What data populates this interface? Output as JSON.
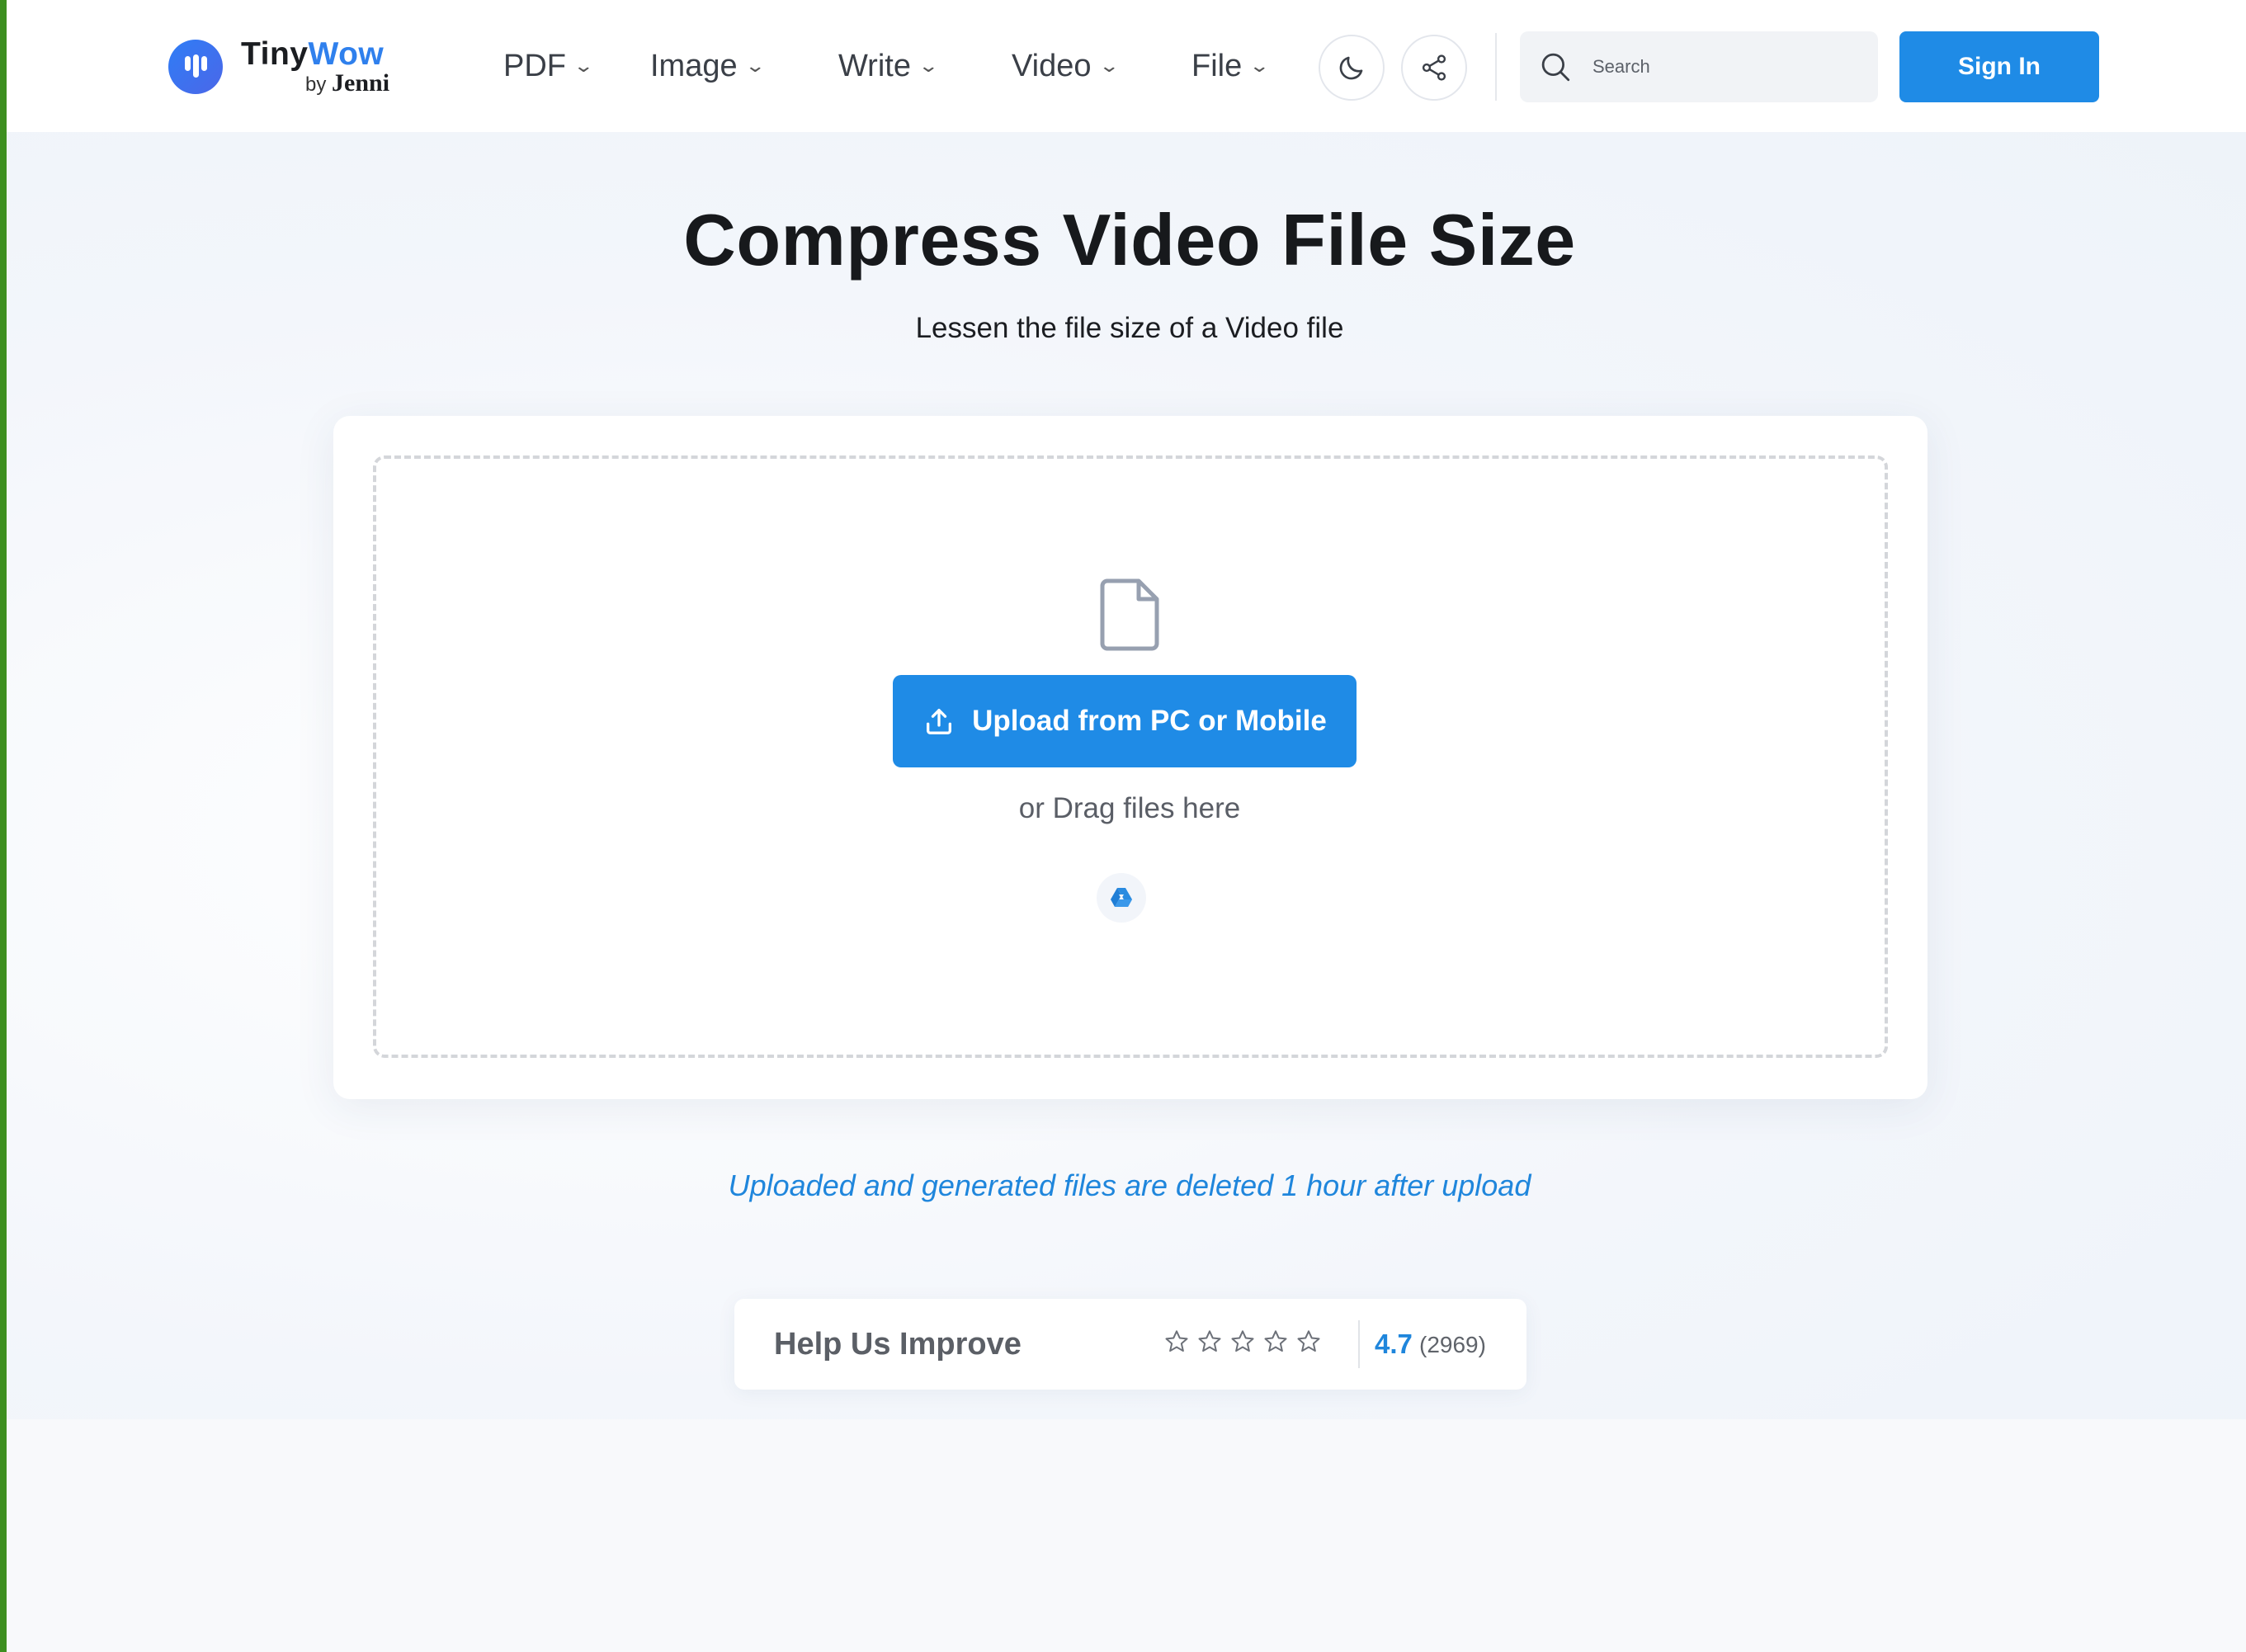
{
  "header": {
    "logo": {
      "brand_main": "Tiny",
      "brand_accent": "Wow",
      "by": "by",
      "byline": "Jenni"
    },
    "nav": [
      {
        "label": "PDF"
      },
      {
        "label": "Image"
      },
      {
        "label": "Write"
      },
      {
        "label": "Video"
      },
      {
        "label": "File"
      }
    ],
    "search": {
      "placeholder": "Search"
    },
    "sign_in_label": "Sign In",
    "icons": {
      "theme": "moon-icon",
      "share": "share-icon"
    }
  },
  "main": {
    "title": "Compress Video File Size",
    "subtitle": "Lessen the file size of a Video file",
    "upload": {
      "button_label": "Upload from PC or Mobile",
      "drag_text": "or Drag files here"
    },
    "notice": "Uploaded and generated files are deleted 1 hour after upload"
  },
  "rating": {
    "label": "Help Us Improve",
    "score": "4.7",
    "count": "(2969)"
  },
  "colors": {
    "accent": "#1f8be6",
    "link": "#1f86dc",
    "title": "#17191c"
  }
}
